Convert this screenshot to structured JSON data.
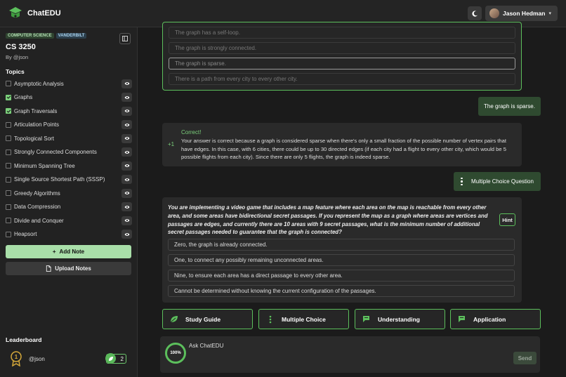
{
  "app": {
    "brand_prefix": "Chat",
    "brand_suffix": "EDU"
  },
  "header": {
    "user_name": "Jason Hedman",
    "theme_icon": "moon-icon"
  },
  "sidebar": {
    "tags": [
      "COMPUTER SCIENCE",
      "VANDERBILT"
    ],
    "course": "CS 3250",
    "byline": "By @json",
    "topics_heading": "Topics",
    "topics": [
      {
        "label": "Asymptotic Analysis",
        "checked": false
      },
      {
        "label": "Graphs",
        "checked": true
      },
      {
        "label": "Graph Traversals",
        "checked": true
      },
      {
        "label": "Articulation Points",
        "checked": false
      },
      {
        "label": "Topological Sort",
        "checked": false
      },
      {
        "label": "Strongly Connected Components",
        "checked": false
      },
      {
        "label": "Minimum Spanning Tree",
        "checked": false
      },
      {
        "label": "Single Source Shortest Path (SSSP)",
        "checked": false
      },
      {
        "label": "Greedy Algorithms",
        "checked": false
      },
      {
        "label": "Data Compression",
        "checked": false
      },
      {
        "label": "Divide and Conquer",
        "checked": false
      },
      {
        "label": "Heapsort",
        "checked": false
      }
    ],
    "add_note": "Add Note",
    "upload_notes": "Upload Notes",
    "leaderboard_title": "Leaderboard",
    "leaderboard_user": "@json",
    "leaderboard_score": "2"
  },
  "chat": {
    "prev_options": [
      "The graph has a self-loop.",
      "The graph is strongly connected.",
      "The graph is sparse.",
      "There is a path from every city to every other city."
    ],
    "user_answer": "The graph is sparse.",
    "feedback_points": "+1",
    "feedback_title": "Correct!",
    "feedback_text": "Your answer is correct because a graph is considered sparse when there's only a small fraction of the possible number of vertex pairs that have edges. In this case, with 6 cities, there could be up to 30 directed edges (if each city had a flight to every other city, which would be 5 possible flights from each city). Since there are only 5 flights, the graph is indeed sparse.",
    "mcq_label": "Multiple Choice Question",
    "question": "You are implementing a video game that includes a map feature where each area on the map is reachable from every other area, and some areas have bidirectional secret passages. If you represent the map as a graph where areas are vertices and passages are edges, and currently there are 10 areas with 9 secret passages, what is the minimum number of additional secret passages needed to guarantee that the graph is connected?",
    "hint": "Hint",
    "options": [
      "Zero, the graph is already connected.",
      "One, to connect any possibly remaining unconnected areas.",
      "Nine, to ensure each area has a direct passage to every other area.",
      "Cannot be determined without knowing the current configuration of the passages."
    ]
  },
  "actions": [
    "Study Guide",
    "Multiple Choice",
    "Understanding",
    "Application"
  ],
  "ask": {
    "label": "Ask ChatEDU",
    "progress": "100%",
    "send": "Send",
    "value": ""
  },
  "colors": {
    "accent": "#5cbf5c",
    "accent_light": "#a9dfa9",
    "bubble": "#2f4a30"
  }
}
